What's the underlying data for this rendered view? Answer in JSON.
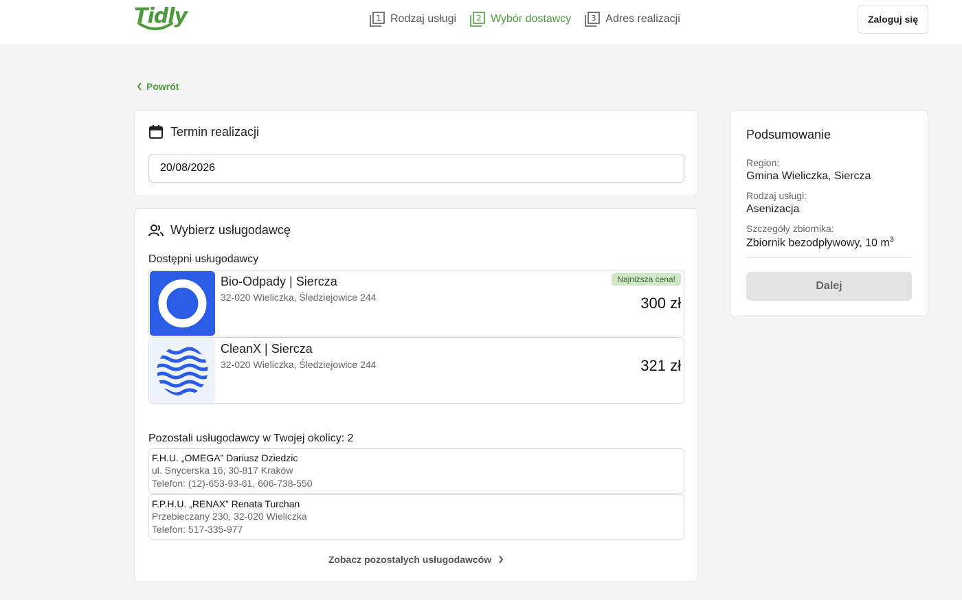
{
  "header": {
    "logo": "Tidly",
    "steps": [
      {
        "num": "1",
        "label": "Rodzaj usługi"
      },
      {
        "num": "2",
        "label": "Wybór dostawcy"
      },
      {
        "num": "3",
        "label": "Adres realizacji"
      }
    ],
    "active_step": 2,
    "login_label": "Zaloguj się"
  },
  "back_label": "Powrót",
  "date_section": {
    "title": "Termin realizacji",
    "date_value": "20/08/2026"
  },
  "providers_section": {
    "title": "Wybierz usługodawcę",
    "available_label": "Dostępni usługodawcy",
    "available": [
      {
        "name": "Bio-Odpady | Siercza",
        "address": "32-020 Wieliczka, Śledziejowice 244",
        "badge": "Najniższa cena!",
        "price": "300 zł"
      },
      {
        "name": "CleanX | Siercza",
        "address": "32-020 Wieliczka, Śledziejowice 244",
        "badge": "",
        "price": "321 zł"
      }
    ],
    "others_label": "Pozostali usługodawcy w Twojej okolicy: 2",
    "others": [
      {
        "name": "F.H.U. „OMEGA” Dariusz Dziedzic",
        "address": "ul. Snycerska 16, 30-817 Kraków",
        "phone": "Telefon: (12)-653-93-61, 606-738-550"
      },
      {
        "name": "F.P.H.U. „RENAX” Renata Turchan",
        "address": "Przebieczany 230, 32-020 Wieliczka",
        "phone": "Telefon: 517-335-977"
      }
    ],
    "see_more_label": "Zobacz pozostałych usługodawców"
  },
  "summary": {
    "title": "Podsumowanie",
    "region_label": "Region:",
    "region_value": "Gmina Wieliczka, Siercza",
    "service_label": "Rodzaj usługi:",
    "service_value": "Asenizacja",
    "tank_label": "Szczegóły zbiornika:",
    "tank_value": "Zbiornik bezodpływowy, 10 m",
    "tank_sup": "3",
    "next_label": "Dalej"
  },
  "colors": {
    "brand": "#4e9a3e",
    "badge_bg": "#cfe6c8",
    "logo_blue": "#2b5ce6"
  }
}
